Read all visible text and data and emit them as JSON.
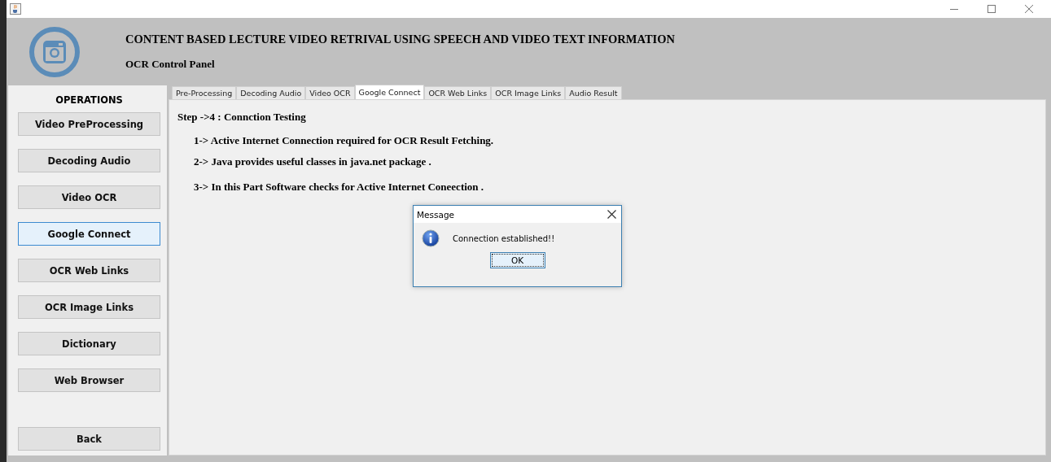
{
  "header": {
    "title": "CONTENT BASED LECTURE VIDEO RETRIVAL USING SPEECH AND VIDEO TEXT INFORMATION",
    "subtitle": "OCR Control Panel"
  },
  "sidebar": {
    "heading": "OPERATIONS",
    "items": [
      {
        "label": "Video PreProcessing",
        "selected": false
      },
      {
        "label": "Decoding Audio",
        "selected": false
      },
      {
        "label": "Video OCR",
        "selected": false
      },
      {
        "label": "Google Connect",
        "selected": true
      },
      {
        "label": "OCR Web Links",
        "selected": false
      },
      {
        "label": "OCR Image Links",
        "selected": false
      },
      {
        "label": "Dictionary",
        "selected": false
      },
      {
        "label": "Web Browser",
        "selected": false
      }
    ],
    "back": "Back"
  },
  "tabs": [
    {
      "label": "Pre-Processing",
      "selected": false
    },
    {
      "label": "Decoding Audio",
      "selected": false
    },
    {
      "label": "Video OCR",
      "selected": false
    },
    {
      "label": "Google Connect",
      "selected": true
    },
    {
      "label": "OCR Web Links",
      "selected": false
    },
    {
      "label": "OCR Image Links",
      "selected": false
    },
    {
      "label": "Audio Result",
      "selected": false
    }
  ],
  "content": {
    "heading": "Step ->4 : Connction Testing",
    "lines": [
      "1-> Active Internet Connection required for OCR Result Fetching.",
      "2-> Java provides useful classes in java.net package .",
      "3-> In this Part Software checks for Active Internet Coneection ."
    ]
  },
  "dialog": {
    "title": "Message",
    "message": "Connection established!!",
    "button": "OK"
  }
}
